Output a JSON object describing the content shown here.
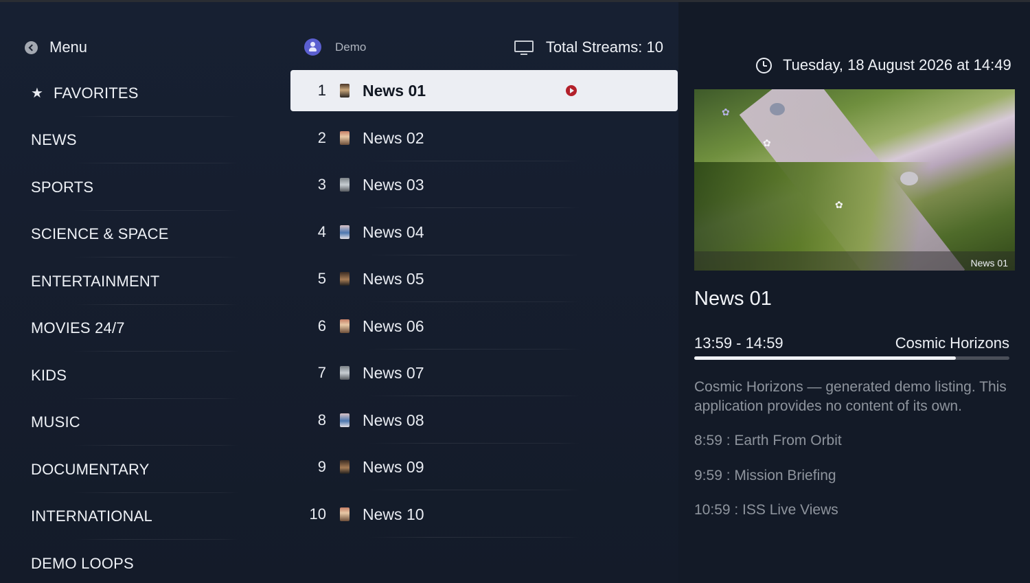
{
  "header": {
    "menu_label": "Menu",
    "user_name": "Demo",
    "total_streams": "Total Streams: 10"
  },
  "categories": [
    {
      "label": "FAVORITES",
      "icon": "star-icon"
    },
    {
      "label": "NEWS"
    },
    {
      "label": "SPORTS"
    },
    {
      "label": "SCIENCE & SPACE"
    },
    {
      "label": "ENTERTAINMENT"
    },
    {
      "label": "MOVIES 24/7"
    },
    {
      "label": "KIDS"
    },
    {
      "label": "MUSIC"
    },
    {
      "label": "DOCUMENTARY"
    },
    {
      "label": "INTERNATIONAL"
    },
    {
      "label": "DEMO LOOPS"
    }
  ],
  "channels": [
    {
      "number": "1",
      "name": "News 01",
      "selected": true,
      "playing": true
    },
    {
      "number": "2",
      "name": "News 02"
    },
    {
      "number": "3",
      "name": "News 03"
    },
    {
      "number": "4",
      "name": "News 04"
    },
    {
      "number": "5",
      "name": "News 05"
    },
    {
      "number": "6",
      "name": "News 06"
    },
    {
      "number": "7",
      "name": "News 07"
    },
    {
      "number": "8",
      "name": "News 08"
    },
    {
      "number": "9",
      "name": "News 09"
    },
    {
      "number": "10",
      "name": "News 10"
    }
  ],
  "details": {
    "datetime": "Tuesday, 18 August 2026 at 14:49",
    "preview_caption": "News 01",
    "channel_title": "News 01",
    "timeslot": "13:59 - 14:59",
    "show_name": "Cosmic Horizons",
    "progress": 0.83,
    "description": "Cosmic Horizons — generated demo listing. This application provides no content of its own.",
    "upcoming": [
      "8:59 : Earth From Orbit",
      "9:59 : Mission Briefing",
      "10:59 : ISS Live Views"
    ]
  },
  "colors": {
    "background": "#151c29",
    "selected_row": "#eceef3",
    "play_accent": "#b3202a",
    "avatar": "#5b5fd0"
  }
}
